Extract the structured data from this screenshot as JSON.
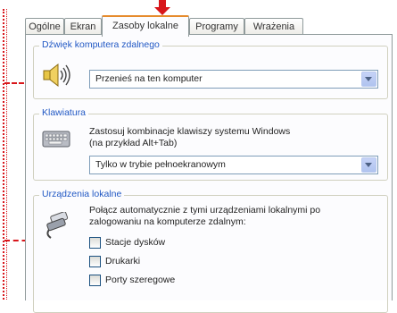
{
  "tabs": [
    "Ogólne",
    "Ekran",
    "Zasoby lokalne",
    "Programy",
    "Wrażenia"
  ],
  "active_tab": "Zasoby lokalne",
  "sound": {
    "group_title": "Dźwięk komputera zdalnego",
    "combo_value": "Przenieś na ten komputer",
    "icon": "speaker-icon"
  },
  "keyboard": {
    "group_title": "Klawiatura",
    "description": [
      "Zastosuj kombinacje klawiszy systemu Windows",
      "(na przykład Alt+Tab)"
    ],
    "combo_value": "Tylko w trybie pełnoekranowym",
    "icon": "keyboard-icon"
  },
  "devices": {
    "group_title": "Urządzenia lokalne",
    "description": [
      "Połącz automatycznie z tymi urządzeniami lokalnymi po",
      "zalogowaniu na komputerze zdalnym:"
    ],
    "checkboxes": [
      "Stacje dysków",
      "Drukarki",
      "Porty szeregowe"
    ],
    "icon": "plug-icon"
  },
  "colors": {
    "accent_red": "#d8161b",
    "group_title": "#2158c4",
    "tab_highlight": "#e68b2c"
  }
}
